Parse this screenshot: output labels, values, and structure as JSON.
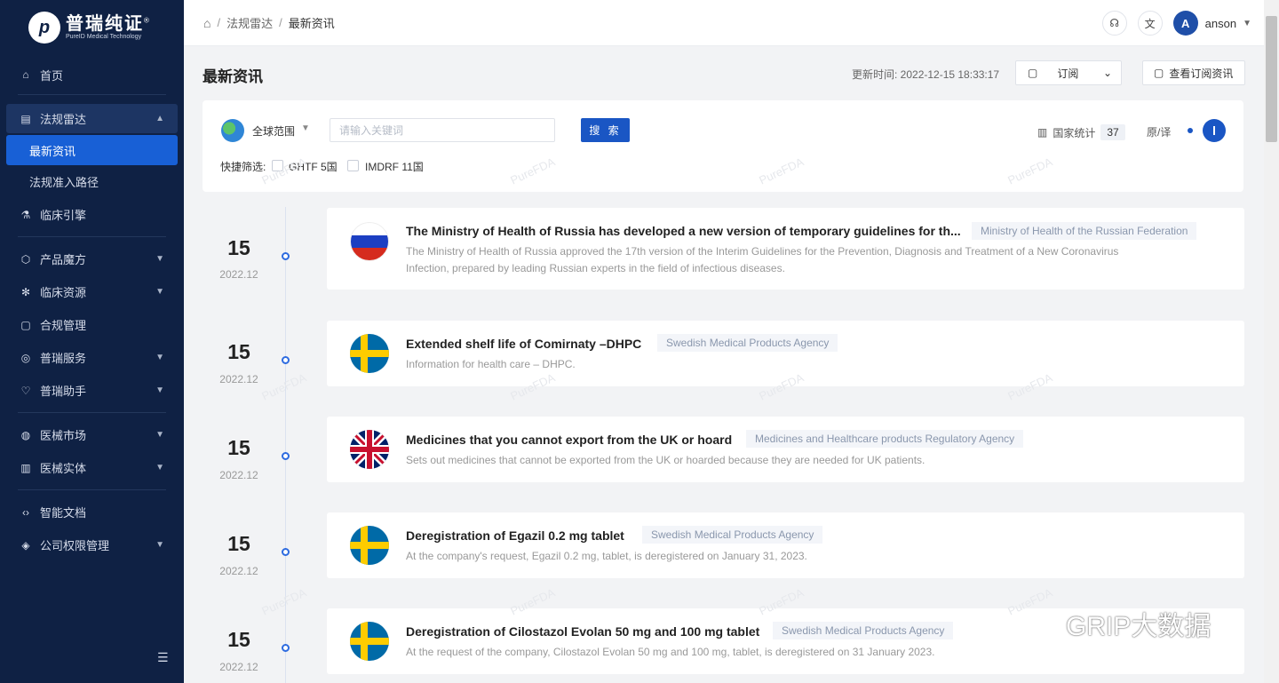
{
  "brand": {
    "logo_cn": "普瑞纯证",
    "logo_en": "PureID Medical Technology",
    "mark": "®"
  },
  "sidebar": {
    "items": [
      {
        "label": "首页",
        "icon": "home-icon"
      },
      {
        "label": "法规雷达",
        "icon": "radar-icon",
        "open": true,
        "children": [
          {
            "label": "最新资讯",
            "active": true
          },
          {
            "label": "法规准入路径"
          }
        ]
      },
      {
        "label": "临床引擎",
        "icon": "flask-icon"
      },
      {
        "label": "产品魔方",
        "icon": "cube-icon"
      },
      {
        "label": "临床资源",
        "icon": "snowflake-icon"
      },
      {
        "label": "合规管理",
        "icon": "document-icon"
      },
      {
        "label": "普瑞服务",
        "icon": "compass-icon"
      },
      {
        "label": "普瑞助手",
        "icon": "heart-icon"
      },
      {
        "label": "医械市场",
        "icon": "globe-icon"
      },
      {
        "label": "医械实体",
        "icon": "building-icon"
      },
      {
        "label": "智能文档",
        "icon": "code-icon"
      },
      {
        "label": "公司权限管理",
        "icon": "layers-icon"
      }
    ]
  },
  "breadcrumb": {
    "items": [
      "法规雷达",
      "最新资讯"
    ],
    "sep": "/"
  },
  "user": {
    "initial": "A",
    "name": "anson"
  },
  "page": {
    "title": "最新资讯",
    "update_time": "更新时间: 2022-12-15 18:33:17",
    "subscribe_label": "订阅",
    "view_sub_label": "查看订阅资讯"
  },
  "filter": {
    "scope": "全球范围",
    "placeholder": "请输入关键词",
    "search_label": "搜 索",
    "quick_label": "快捷筛选:",
    "quick_options": [
      "GHTF 5国",
      "IMDRF 11国"
    ],
    "stat_label": "国家统计",
    "stat_count": "37",
    "translate_label": "原/译"
  },
  "news": [
    {
      "day": "15",
      "month": "2022.12",
      "flag": "russia",
      "title": "The Ministry of Health of Russia has developed a new version of temporary guidelines for th...",
      "agency": "Ministry of Health of the Russian Federation",
      "desc": "The Ministry of Health of Russia approved the 17th version of the Interim Guidelines for the Prevention, Diagnosis and Treatment of a New Coronavirus Infection, prepared by leading Russian experts in the field of infectious diseases."
    },
    {
      "day": "15",
      "month": "2022.12",
      "flag": "sweden",
      "title": "Extended shelf life of Comirnaty –DHPC",
      "agency": "Swedish Medical Products Agency",
      "desc": "Information for health care – DHPC."
    },
    {
      "day": "15",
      "month": "2022.12",
      "flag": "uk",
      "title": "Medicines that you cannot export from the UK or hoard",
      "agency": "Medicines and Healthcare products Regulatory Agency",
      "desc": "Sets out medicines that cannot be exported from the UK or hoarded because they are needed for UK patients."
    },
    {
      "day": "15",
      "month": "2022.12",
      "flag": "sweden",
      "title": "Deregistration of Egazil 0.2 mg tablet",
      "agency": "Swedish Medical Products Agency",
      "desc": "At the company's request, Egazil 0.2 mg, tablet, is deregistered on January 31, 2023."
    },
    {
      "day": "15",
      "month": "2022.12",
      "flag": "sweden",
      "title": "Deregistration of Cilostazol Evolan 50 mg and 100 mg tablet",
      "agency": "Swedish Medical Products Agency",
      "desc": "At the request of the company, Cilostazol Evolan 50 mg and 100 mg, tablet, is deregistered on 31 January 2023."
    }
  ],
  "watermark": "PureFDA",
  "overlay": {
    "text": "GRIP大数据"
  }
}
